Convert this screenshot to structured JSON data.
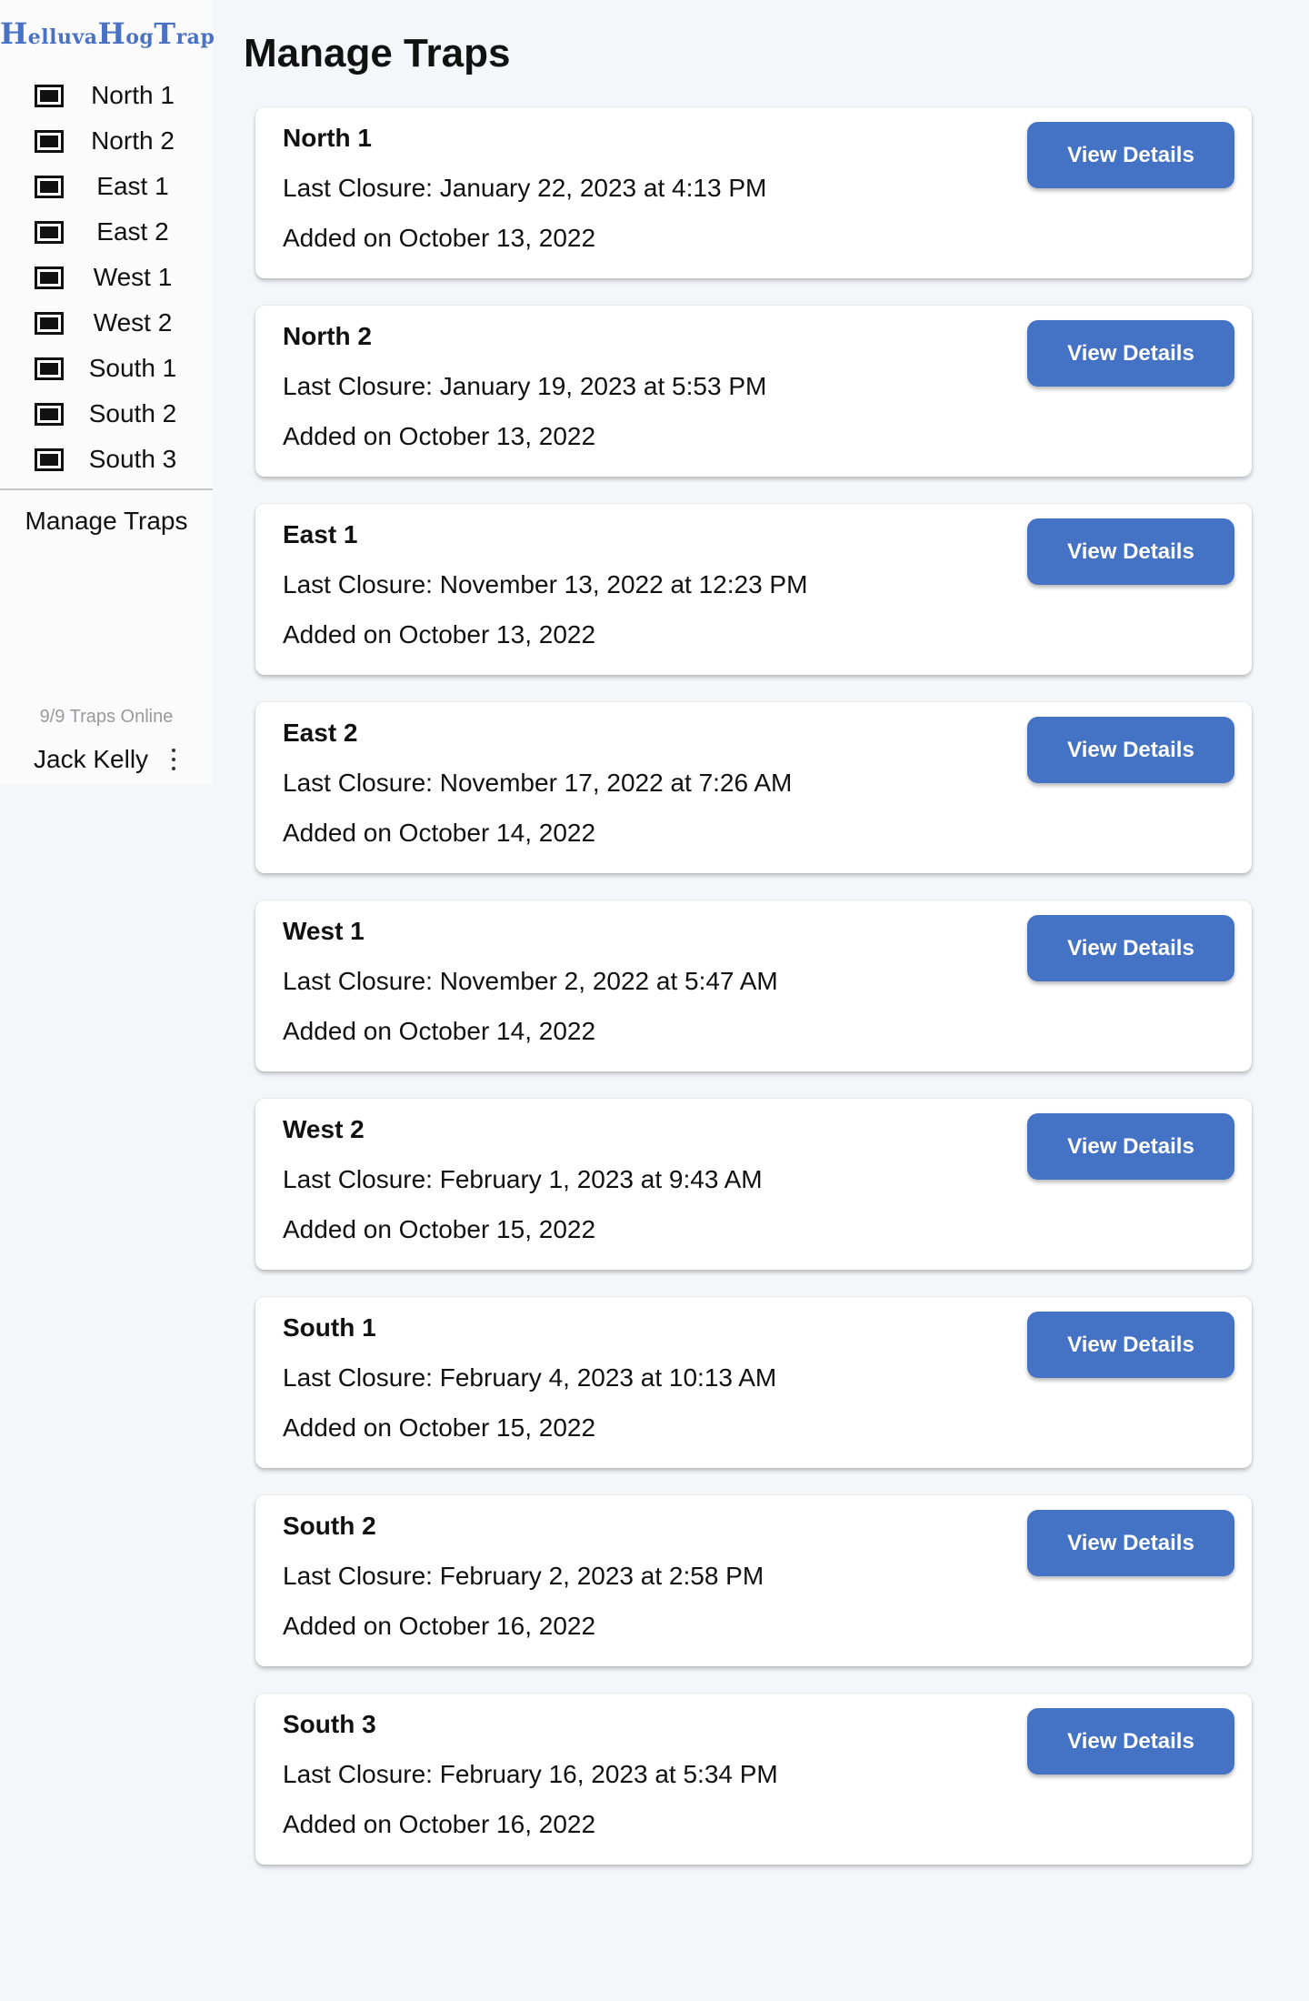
{
  "app": {
    "logo": {
      "part1_initial": "H",
      "part1_rest": "elluva",
      "part2_initial": "H",
      "part2_rest": "og",
      "part3_initial": "T",
      "part3_rest": "rap"
    },
    "brand_color": "#4a72c4",
    "accent_color": "#4472c4"
  },
  "sidebar": {
    "items": [
      {
        "label": "North 1",
        "icon": "trap-icon"
      },
      {
        "label": "North 2",
        "icon": "trap-icon"
      },
      {
        "label": "East 1",
        "icon": "trap-icon"
      },
      {
        "label": "East 2",
        "icon": "trap-icon"
      },
      {
        "label": "West 1",
        "icon": "trap-icon"
      },
      {
        "label": "West 2",
        "icon": "trap-icon"
      },
      {
        "label": "South 1",
        "icon": "trap-icon"
      },
      {
        "label": "South 2",
        "icon": "trap-icon"
      },
      {
        "label": "South 3",
        "icon": "trap-icon"
      }
    ],
    "manage_label": "Manage Traps",
    "status": "9/9 Traps Online",
    "user_name": "Jack Kelly",
    "menu_icon": "more-vertical-icon"
  },
  "main": {
    "title": "Manage Traps",
    "details_label": "View Details",
    "traps": [
      {
        "name": "North 1",
        "closure": "Last Closure: January 22, 2023 at 4:13 PM",
        "added": "Added on October 13, 2022"
      },
      {
        "name": "North 2",
        "closure": "Last Closure: January 19, 2023 at 5:53 PM",
        "added": "Added on October 13, 2022"
      },
      {
        "name": "East 1",
        "closure": "Last Closure: November 13, 2022 at 12:23 PM",
        "added": "Added on October 13, 2022"
      },
      {
        "name": "East 2",
        "closure": "Last Closure: November 17, 2022 at 7:26 AM",
        "added": "Added on October 14, 2022"
      },
      {
        "name": "West 1",
        "closure": "Last Closure: November 2, 2022 at 5:47 AM",
        "added": "Added on October 14, 2022"
      },
      {
        "name": "West 2",
        "closure": "Last Closure: February 1, 2023 at 9:43 AM",
        "added": "Added on October 15, 2022"
      },
      {
        "name": "South 1",
        "closure": "Last Closure: February 4, 2023 at 10:13 AM",
        "added": "Added on October 15, 2022"
      },
      {
        "name": "South 2",
        "closure": "Last Closure: February 2, 2023 at 2:58 PM",
        "added": "Added on October 16, 2022"
      },
      {
        "name": "South 3",
        "closure": "Last Closure: February 16, 2023 at 5:34 PM",
        "added": "Added on October 16, 2022"
      }
    ]
  }
}
